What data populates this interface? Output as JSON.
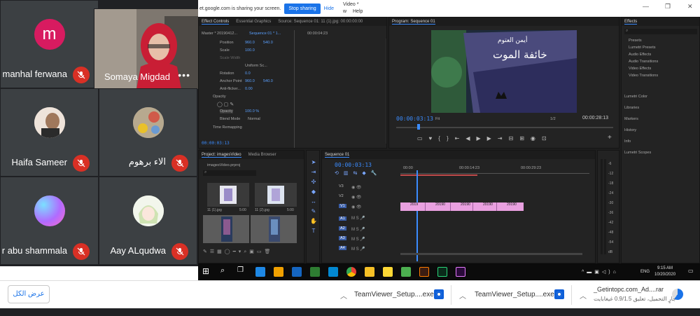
{
  "meet": {
    "participants": [
      {
        "name": "manhal ferwana",
        "initial": "m",
        "avatar_color": "#d81b60"
      },
      {
        "name": "Somaya Migdad",
        "initial": "",
        "avatar_color": "#8a7f76"
      },
      {
        "name": "Haifa Sameer",
        "initial": "",
        "avatar_color": "#e7d7cc"
      },
      {
        "name": "الاء برهوم",
        "initial": "",
        "avatar_color": "#c9b9a2"
      },
      {
        "name": "r abu shammala",
        "initial": "",
        "avatar_color": "#9b7be0"
      },
      {
        "name": "Aay ALqudwa",
        "initial": "",
        "avatar_color": "#d9e8c6"
      }
    ],
    "more_icon": "more-dots-icon"
  },
  "share": {
    "sharing_text": "et.google.com is sharing your screen.",
    "stop_label": "Stop sharing",
    "hide_label": "Hide"
  },
  "premiere": {
    "title_fragment": "Video *",
    "menu_fragment_1": "w",
    "menu_fragment_2": "Help",
    "effect_controls": {
      "tabs": [
        "Effect Controls",
        "Essential Graphics",
        "Source: Sequence 01: 11 (1).jpg: 00:00:00:00"
      ],
      "master_label": "Master * 20190412...",
      "sequence_label": "Sequence 01 * 1...",
      "timecode_small": "00:00:04:23",
      "rows": [
        {
          "label": "Position",
          "v1": "960.0",
          "v2": "540.0"
        },
        {
          "label": "Scale",
          "v1": "100.0",
          "v2": ""
        },
        {
          "label": "Scale Width",
          "v1": "",
          "v2": ""
        },
        {
          "label": "Uniform Sc...",
          "v1": "",
          "v2": ""
        },
        {
          "label": "Rotation",
          "v1": "0.0",
          "v2": ""
        },
        {
          "label": "Anchor Point",
          "v1": "960.0",
          "v2": "540.0"
        },
        {
          "label": "Anti-flicker...",
          "v1": "0.00",
          "v2": ""
        },
        {
          "label": "Opacity",
          "v1": "",
          "v2": ""
        },
        {
          "label": "Opacity",
          "v1": "100.0 %",
          "v2": ""
        },
        {
          "label": "Blend Mode",
          "v1": "Normal",
          "v2": ""
        },
        {
          "label": "Time Remapping",
          "v1": "",
          "v2": ""
        }
      ],
      "footer_tc": "00:00:03:13"
    },
    "program": {
      "tab": "Program: Sequence 01",
      "title_line1": "أيمن العتوم",
      "title_line2": "خائفة الموت",
      "tc_left": "00:00:03:13",
      "fit": "Fit",
      "ratio": "1/2",
      "tc_right": "00:00:28:13"
    },
    "effects": {
      "tab": "Effects",
      "items": [
        "Presets",
        "Lumetri Presets",
        "Audio Effects",
        "Audio Transitions",
        "Video Effects",
        "Video Transitions"
      ],
      "sections": [
        "Lumetri Color",
        "Libraries",
        "Markers",
        "History",
        "Info",
        "Lumetri Scopes"
      ]
    },
    "project": {
      "tabs": [
        "Project: imagesVideo",
        "Media Browser"
      ],
      "file": "imagesVideo.prproj",
      "thumbs": [
        {
          "name": "11 (1).jpg",
          "dur": "5:00"
        },
        {
          "name": "11 (2).jpg",
          "dur": "5:00"
        }
      ]
    },
    "timeline": {
      "tab": "Sequence 01",
      "tc": "00:00:03:13",
      "ticks": [
        "00:00",
        "00:00:14:23",
        "00:00:29:23"
      ],
      "video_tracks": [
        "V3",
        "V2",
        "V1"
      ],
      "audio_tracks": [
        "A1",
        "A2",
        "A3",
        "A4"
      ],
      "clips": [
        "2019",
        "20190",
        "20190",
        "20190",
        "20190"
      ],
      "meter_labels": [
        "-6",
        "-12",
        "-18",
        "-24",
        "-30",
        "-36",
        "-42",
        "-48",
        "-54",
        "dB"
      ]
    },
    "taskbar": {
      "lang": "ENG",
      "time": "9:15 AM",
      "date": "10/20/2020"
    }
  },
  "downloads": {
    "show_all": "عرض الكل",
    "items": [
      {
        "name": "TeamViewer_Setup....exe"
      },
      {
        "name": "TeamViewer_Setup....exe"
      },
      {
        "name": "_Getintopc.com_Ad....rar",
        "status": "جارٍ التحميل، تعليق 0.9/1.5 غيغابايت"
      }
    ]
  },
  "colors": {
    "meet_bg": "#202124",
    "tile_bg": "#3c4043",
    "mic_red": "#d93025",
    "premiere_blue": "#3b8cff",
    "clip_pink": "#e9a0e0"
  }
}
